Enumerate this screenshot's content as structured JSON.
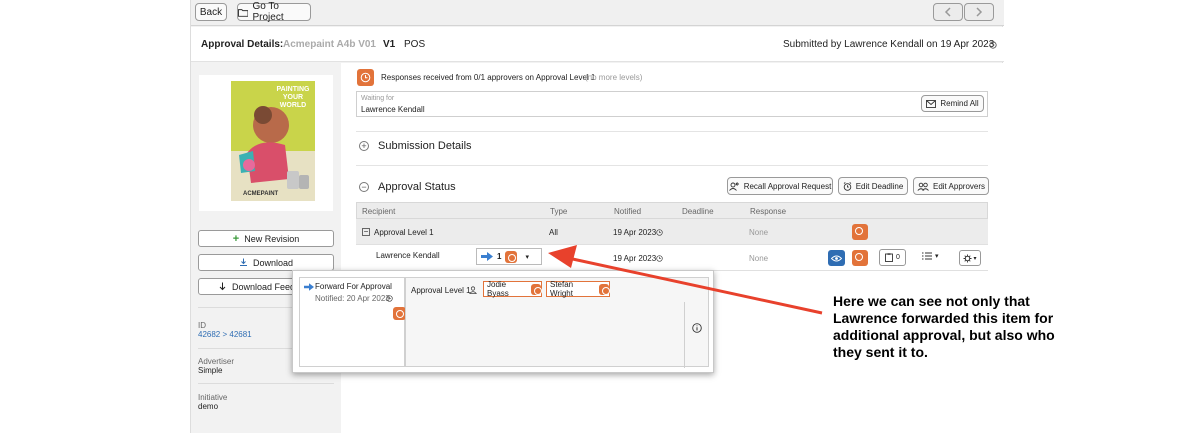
{
  "topbar": {
    "back_label": "Back",
    "goto_label": "Go To Project"
  },
  "header": {
    "title_prefix": "Approval Details:",
    "asset_name": "Acmepaint A4b V01",
    "version": "V1",
    "type": "POS",
    "submitted": "Submitted by Lawrence Kendall on 19 Apr 2023"
  },
  "poster": {
    "headline_1": "PAINTING",
    "headline_2": "YOUR",
    "headline_3": "WORLD",
    "brand": "ACMEPAINT"
  },
  "sidebar": {
    "new_revision": "New Revision",
    "download": "Download",
    "download_feedback": "Download Feedback",
    "id_label": "ID",
    "id_value": "42682 > 42681",
    "advertiser_label": "Advertiser",
    "advertiser_value": "Simple",
    "initiative_label": "Initiative",
    "initiative_value": "demo"
  },
  "responses": {
    "summary": "Responses received from 0/1 approvers on Approval Level 1",
    "no_more": "(no more levels)",
    "waiting_label": "Waiting for",
    "waiting_value": "Lawrence Kendall",
    "remind_label": "Remind All"
  },
  "sections": {
    "submission": "Submission Details",
    "approval_status": "Approval Status"
  },
  "actions": {
    "recall": "Recall Approval Request",
    "edit_deadline": "Edit Deadline",
    "edit_approvers": "Edit Approvers"
  },
  "table": {
    "headers": [
      "Recipient",
      "Type",
      "Notified",
      "Deadline",
      "Response"
    ],
    "level_row": {
      "name": "Approval Level 1",
      "type": "All",
      "notified": "19 Apr 2023",
      "response": "None"
    },
    "person_row": {
      "name": "Lawrence Kendall",
      "forward_count": "1",
      "notified": "19 Apr 2023",
      "response": "None",
      "comments": "0"
    }
  },
  "popup": {
    "title": "Forward For Approval",
    "notified": "Notified: 20 Apr 2023",
    "level": "Approval Level 1",
    "recipients": [
      "Jodie Byass",
      "Stefan Wright"
    ]
  },
  "annotation": "Here we can see not only that Lawrence forwarded this item for additional approval, but also who they sent it to.",
  "colors": {
    "accent_orange": "#e2733a",
    "arrow_red": "#e8412c",
    "view_blue": "#2f6db3"
  }
}
